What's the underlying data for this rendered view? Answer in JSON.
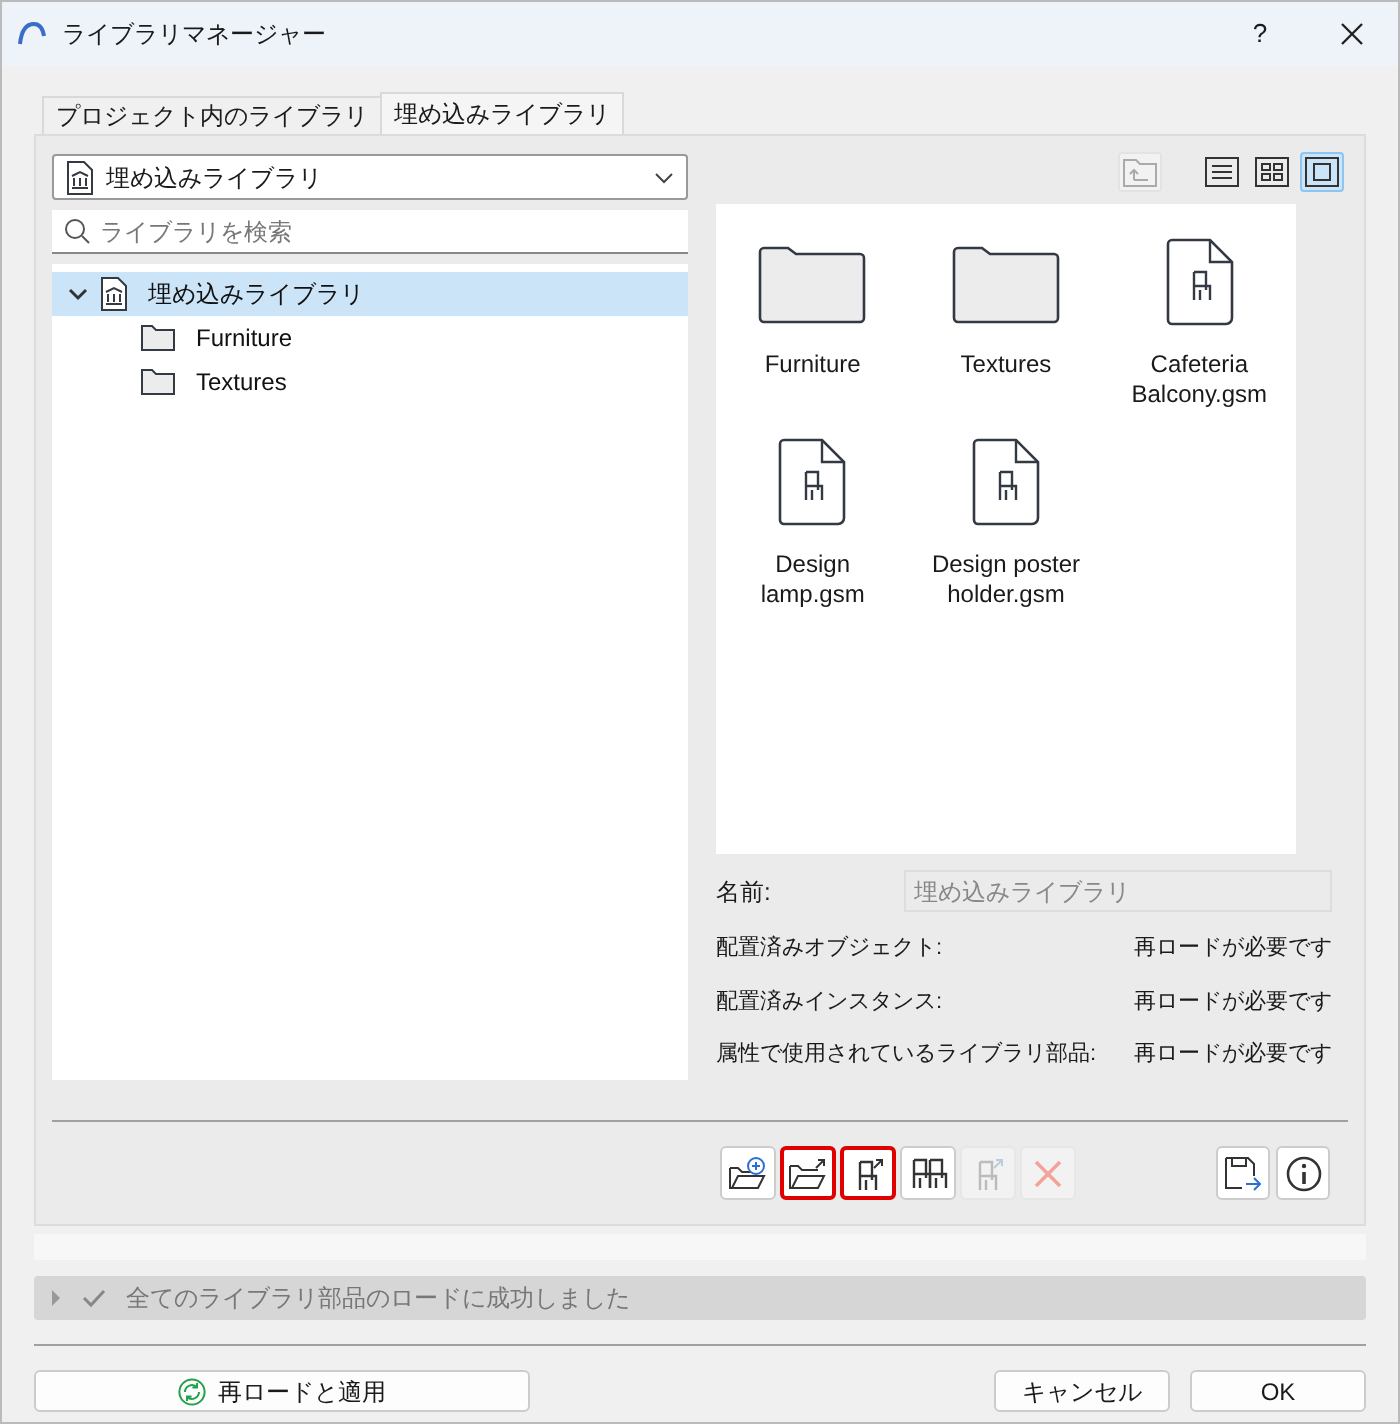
{
  "window": {
    "title": "ライブラリマネージャー",
    "help": "?"
  },
  "tabs": [
    {
      "label": "プロジェクト内のライブラリ",
      "selected": false
    },
    {
      "label": "埋め込みライブラリ",
      "selected": true
    }
  ],
  "library_select": {
    "value": "埋め込みライブラリ"
  },
  "search": {
    "placeholder": "ライブラリを検索"
  },
  "tree": [
    {
      "label": "埋め込みライブラリ",
      "kind": "library",
      "expanded": true,
      "selected": true,
      "children": [
        {
          "label": "Furniture",
          "kind": "folder",
          "selected": false
        },
        {
          "label": "Textures",
          "kind": "folder",
          "selected": false
        }
      ]
    }
  ],
  "view_buttons": [
    {
      "kind": "up",
      "disabled": true,
      "selected": false
    },
    {
      "kind": "list",
      "disabled": false,
      "selected": false
    },
    {
      "kind": "grid",
      "disabled": false,
      "selected": false
    },
    {
      "kind": "large",
      "disabled": false,
      "selected": true
    }
  ],
  "items": [
    {
      "label": "Furniture",
      "kind": "folder"
    },
    {
      "label": "Textures",
      "kind": "folder"
    },
    {
      "label": "Cafeteria Balcony.gsm",
      "kind": "object"
    },
    {
      "label": "Design lamp.gsm",
      "kind": "object"
    },
    {
      "label": "Design poster holder.gsm",
      "kind": "object"
    }
  ],
  "details": {
    "name_label": "名前:",
    "name_value": "埋め込みライブラリ",
    "rows": [
      {
        "label": "配置済みオブジェクト:",
        "value": "再ロードが必要です"
      },
      {
        "label": "配置済みインスタンス:",
        "value": "再ロードが必要です"
      },
      {
        "label": "属性で使用されているライブラリ部品:",
        "value": "再ロードが必要です"
      }
    ]
  },
  "toolbar": [
    {
      "kind": "add-folder",
      "highlighted": false,
      "disabled": false
    },
    {
      "kind": "export-folder",
      "highlighted": true,
      "disabled": false
    },
    {
      "kind": "export-object",
      "highlighted": true,
      "disabled": false
    },
    {
      "kind": "objects",
      "highlighted": false,
      "disabled": false
    },
    {
      "kind": "export-object",
      "highlighted": false,
      "disabled": true
    },
    {
      "kind": "delete",
      "highlighted": false,
      "disabled": true
    }
  ],
  "toolbar_right": [
    {
      "kind": "save"
    },
    {
      "kind": "info"
    }
  ],
  "status": {
    "text": "全てのライブラリ部品のロードに成功しました",
    "expanded": false
  },
  "buttons": [
    {
      "label": "再ロードと適用",
      "kind": "reload"
    },
    {
      "label": "キャンセル",
      "kind": "cancel"
    },
    {
      "label": "OK",
      "kind": "default"
    }
  ]
}
